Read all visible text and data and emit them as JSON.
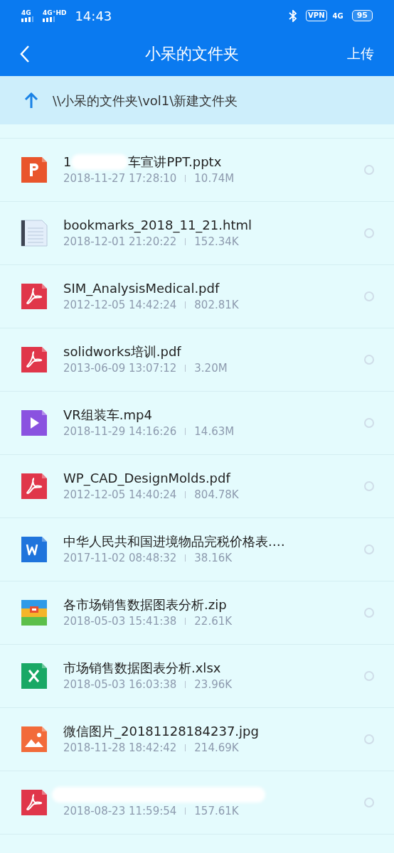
{
  "status_bar": {
    "signal_1": "4G",
    "signal_2": "4G⁺HD",
    "time": "14:43",
    "vpn": "VPN",
    "network": "4G",
    "battery": "95"
  },
  "header": {
    "title": "小呆的文件夹",
    "action": "上传"
  },
  "path": "\\\\小呆的文件夹\\vol1\\新建文件夹",
  "files": [
    {
      "kind": "pptx",
      "name_start": "1",
      "redacted": true,
      "name_end": "车宣讲PPT.pptx",
      "date": "2018-11-27 17:28:10",
      "size": "10.74M",
      "selected": false
    },
    {
      "kind": "html",
      "name_start": "bookmarks_2018_11_21.html",
      "redacted": false,
      "date": "2018-12-01 21:20:22",
      "size": "152.34K",
      "selected": false
    },
    {
      "kind": "pdf",
      "name_start": "SIM_AnalysisMedical.pdf",
      "redacted": false,
      "date": "2012-12-05 14:42:24",
      "size": "802.81K",
      "selected": false
    },
    {
      "kind": "pdf",
      "name_start": "solidworks培训.pdf",
      "redacted": false,
      "date": "2013-06-09 13:07:12",
      "size": "3.20M",
      "selected": false
    },
    {
      "kind": "video",
      "name_start": "VR组装车.mp4",
      "redacted": false,
      "date": "2018-11-29 14:16:26",
      "size": "14.63M",
      "selected": false
    },
    {
      "kind": "pdf",
      "name_start": "WP_CAD_DesignMolds.pdf",
      "redacted": false,
      "date": "2012-12-05 14:40:24",
      "size": "804.78K",
      "selected": false
    },
    {
      "kind": "word",
      "name_start": "中华人民共和国进境物品完税价格表.…",
      "redacted": false,
      "date": "2017-11-02 08:48:32",
      "size": "38.16K",
      "selected": false
    },
    {
      "kind": "zip",
      "name_start": "各市场销售数据图表分析.zip",
      "redacted": false,
      "date": "2018-05-03 15:41:38",
      "size": "22.61K",
      "selected": false
    },
    {
      "kind": "excel",
      "name_start": "市场销售数据图表分析.xlsx",
      "redacted": false,
      "date": "2018-05-03 16:03:38",
      "size": "23.96K",
      "selected": false
    },
    {
      "kind": "image",
      "name_start": "微信图片_20181128184237.jpg",
      "redacted": false,
      "date": "2018-11-28 18:42:42",
      "size": "214.69K",
      "selected": false
    },
    {
      "kind": "pdf",
      "redacted": true,
      "date": "2018-08-23 11:59:54",
      "size": "157.61K",
      "selected": false
    }
  ]
}
